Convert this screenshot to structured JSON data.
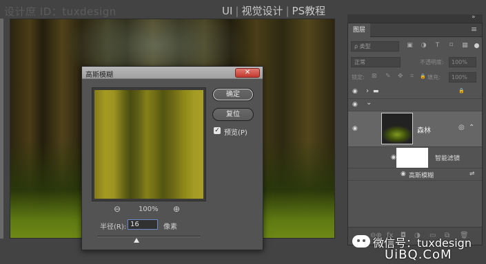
{
  "header": {
    "designer": "设计庶 ID：tuxdesign",
    "title_ui": "UI",
    "title_visual": "视觉设计",
    "title_ps": "PS教程",
    "separator": "|"
  },
  "dialog": {
    "title": "高斯模糊",
    "close_label": "✕",
    "ok_label": "确定",
    "reset_label": "复位",
    "preview_label": "预览(P)",
    "preview_checked": true,
    "zoom_out": "⊖",
    "zoom_value": "100%",
    "zoom_in": "⊕",
    "radius_label": "半径(R):",
    "radius_value": "16",
    "unit": "像素",
    "slider_fraction": 0.38
  },
  "layers_panel": {
    "tab": "图层",
    "menu_icon": "≡",
    "kind_label": "ρ 类型",
    "filter_icons": [
      "▣",
      "◑",
      "T",
      "⌑",
      "▦"
    ],
    "blend_mode": "正常",
    "opacity_label": "不透明度:",
    "opacity_value": "100%",
    "lock_label": "锁定:",
    "lock_icons": [
      "⊠",
      "✎",
      "✥",
      "⌗",
      "🔒"
    ],
    "fill_label": "填充:",
    "fill_value": "100%",
    "group_chevron": "›",
    "sub_chevron": "⌄",
    "group_lock": "🔒",
    "layer_name": "森林",
    "smart_filter_label": "智能滤镜",
    "filter_item_label": "高斯模糊",
    "bottom_icons": [
      "⊖⊕",
      "fx",
      "◘",
      "◑",
      "▭",
      "⧉",
      "🗑"
    ]
  },
  "watermark": {
    "wechat": "微信号：tuxdesign",
    "footer": "UiBQ.CoM"
  }
}
